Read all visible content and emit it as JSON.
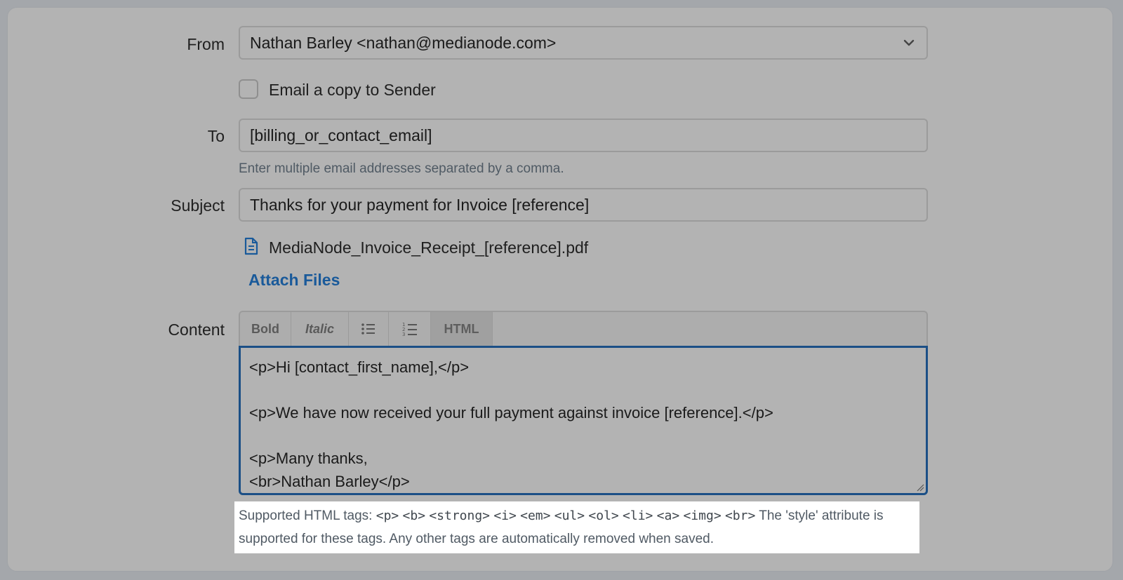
{
  "form": {
    "from_label": "From",
    "from_value": "Nathan Barley <nathan@medianode.com>",
    "copy_sender_label": "Email a copy to Sender",
    "copy_sender_checked": false,
    "to_label": "To",
    "to_value": "[billing_or_contact_email]",
    "to_help": "Enter multiple email addresses separated by a comma.",
    "subject_label": "Subject",
    "subject_value": "Thanks for your payment for Invoice [reference]",
    "attachment_name": "MediaNode_Invoice_Receipt_[reference].pdf",
    "attach_files_label": "Attach Files",
    "content_label": "Content"
  },
  "toolbar": {
    "bold": "Bold",
    "italic": "Italic",
    "bullet_list_icon": "bullet-list-icon",
    "numbered_list_icon": "numbered-list-icon",
    "html": "HTML"
  },
  "editor": {
    "lines": [
      "<p>Hi [contact_first_name],</p>",
      "",
      "<p>We have now received your full payment against invoice [reference].</p>",
      "",
      "<p>Many thanks,",
      "<br>Nathan Barley</p>"
    ]
  },
  "note": {
    "prefix": "Supported HTML tags:",
    "tags": [
      "<p>",
      "<b>",
      "<strong>",
      "<i>",
      "<em>",
      "<ul>",
      "<ol>",
      "<li>",
      "<a>",
      "<img>",
      "<br>"
    ],
    "suffix": "The 'style' attribute is supported for these tags. Any other tags are automatically removed when saved."
  },
  "colors": {
    "background": "#b3b3b3",
    "link": "#1a5a9a",
    "editor_focus_border": "#1b4f86",
    "help_text": "#4f5a64"
  }
}
